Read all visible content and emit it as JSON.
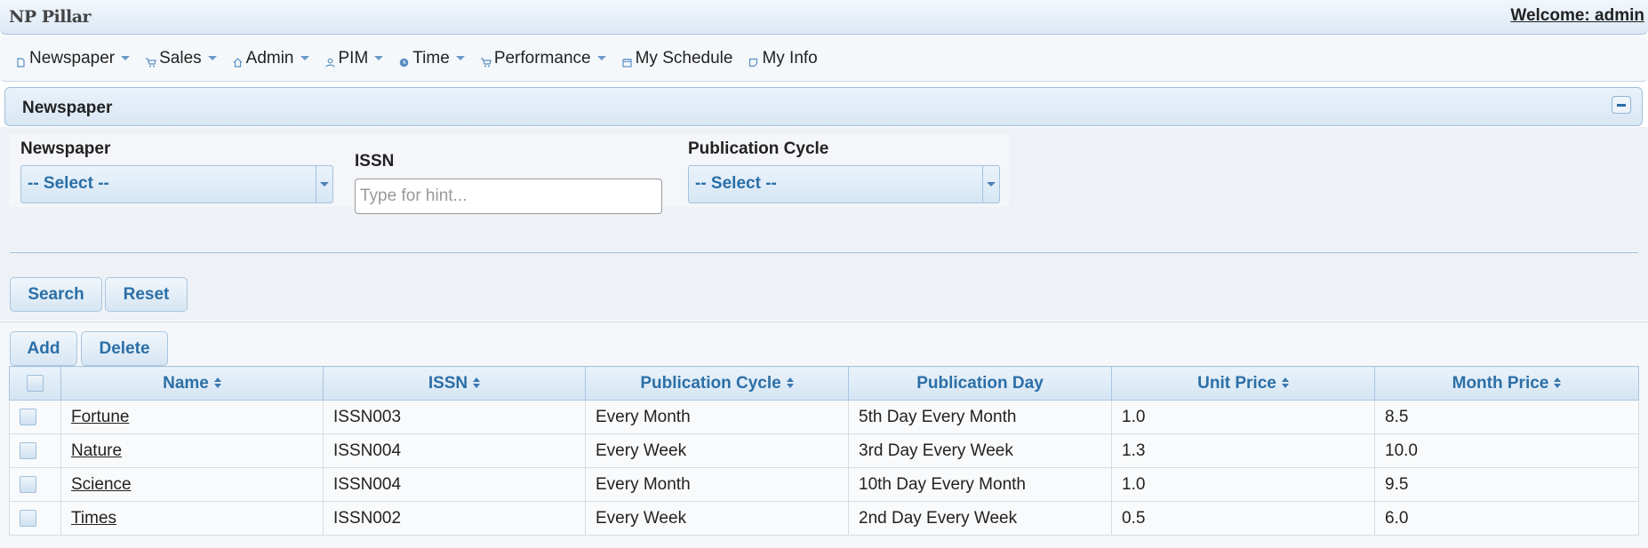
{
  "header": {
    "logo": "NP Pillar",
    "welcome": "Welcome: admin"
  },
  "menu": [
    {
      "label": "Newspaper",
      "icon": "document-icon",
      "has_dropdown": true
    },
    {
      "label": "Sales",
      "icon": "cart-icon",
      "has_dropdown": true
    },
    {
      "label": "Admin",
      "icon": "home-icon",
      "has_dropdown": true
    },
    {
      "label": "PIM",
      "icon": "person-icon",
      "has_dropdown": true
    },
    {
      "label": "Time",
      "icon": "clock-icon",
      "has_dropdown": true
    },
    {
      "label": "Performance",
      "icon": "cart-icon",
      "has_dropdown": true
    },
    {
      "label": "My Schedule",
      "icon": "calendar-icon",
      "has_dropdown": false
    },
    {
      "label": "My Info",
      "icon": "note-icon",
      "has_dropdown": false
    }
  ],
  "panel": {
    "title": "Newspaper"
  },
  "filters": {
    "newspaper_label": "Newspaper",
    "newspaper_value": "-- Select --",
    "issn_label": "ISSN",
    "issn_placeholder": "Type for hint...",
    "cycle_label": "Publication Cycle",
    "cycle_value": "-- Select --",
    "search_label": "Search",
    "reset_label": "Reset"
  },
  "list": {
    "add_label": "Add",
    "delete_label": "Delete",
    "columns": {
      "name": "Name",
      "issn": "ISSN",
      "cycle": "Publication Cycle",
      "day": "Publication Day",
      "unit_price": "Unit Price",
      "month_price": "Month Price"
    },
    "rows": [
      {
        "name": "Fortune",
        "issn": "ISSN003",
        "cycle": "Every Month",
        "day": "5th Day Every Month",
        "unit_price": "1.0",
        "month_price": "8.5"
      },
      {
        "name": "Nature",
        "issn": "ISSN004",
        "cycle": "Every Week",
        "day": "3rd Day Every Week",
        "unit_price": "1.3",
        "month_price": "10.0"
      },
      {
        "name": "Science",
        "issn": "ISSN004",
        "cycle": "Every Month",
        "day": "10th Day Every Month",
        "unit_price": "1.0",
        "month_price": "9.5"
      },
      {
        "name": "Times",
        "issn": "ISSN002",
        "cycle": "Every Week",
        "day": "2nd Day Every Week",
        "unit_price": "0.5",
        "month_price": "6.0"
      }
    ]
  },
  "colors": {
    "accent": "#2c6fa7",
    "header_bg": "#dde9f5",
    "border": "#a9c5df"
  }
}
